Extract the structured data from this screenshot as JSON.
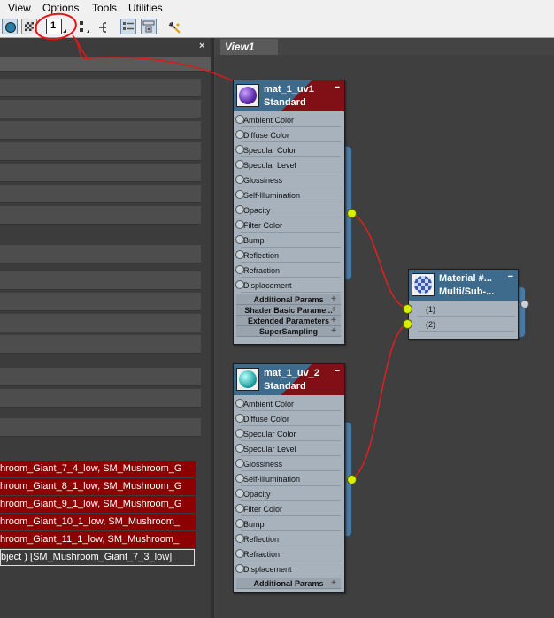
{
  "menu": {
    "items": [
      "View",
      "Options",
      "Tools",
      "Utilities"
    ]
  },
  "toolbar": {
    "layout_button_label": "1"
  },
  "left_panel": {
    "selected_rows": [
      "hroom_Giant_7_4_low, SM_Mushroom_G",
      "hroom_Giant_8_1_low, SM_Mushroom_G",
      "hroom_Giant_9_1_low, SM_Mushroom_G",
      "hroom_Giant_10_1_low, SM_Mushroom_",
      "hroom_Giant_11_1_low, SM_Mushroom_"
    ],
    "status_text": "bject ) [SM_Mushroom_Giant_7_3_low]",
    "close_glyph": "×"
  },
  "view": {
    "tab_label": "View1"
  },
  "nodes": {
    "mat1": {
      "title": "mat_1_uv1",
      "subtitle": "Standard",
      "minimize": "−",
      "slots": [
        "Ambient Color",
        "Diffuse Color",
        "Specular Color",
        "Specular Level",
        "Glossiness",
        "Self-Illumination",
        "Opacity",
        "Filter Color",
        "Bump",
        "Reflection",
        "Refraction",
        "Displacement"
      ],
      "rollouts": [
        "Additional Params",
        "Shader Basic Parame...",
        "Extended Parameters",
        "SuperSampling"
      ]
    },
    "mat2": {
      "title": "mat_1_uv_2",
      "subtitle": "Standard",
      "minimize": "−",
      "slots": [
        "Ambient Color",
        "Diffuse Color",
        "Specular Color",
        "Specular Level",
        "Glossiness",
        "Self-Illumination",
        "Opacity",
        "Filter Color",
        "Bump",
        "Reflection",
        "Refraction",
        "Displacement"
      ],
      "rollouts": [
        "Additional Params"
      ]
    },
    "multi": {
      "title": "Material #...",
      "subtitle": "Multi/Sub-...",
      "minimize": "−",
      "slots": [
        "(1)",
        "(2)"
      ]
    }
  },
  "rollout_glyph": "+",
  "colors": {
    "node_header": "#3e6a8c",
    "node_body": "#a7b2bd",
    "wire": "#e02020",
    "socket_active": "#d8f000",
    "annotation": "#e01818",
    "selection": "#8b0000"
  }
}
